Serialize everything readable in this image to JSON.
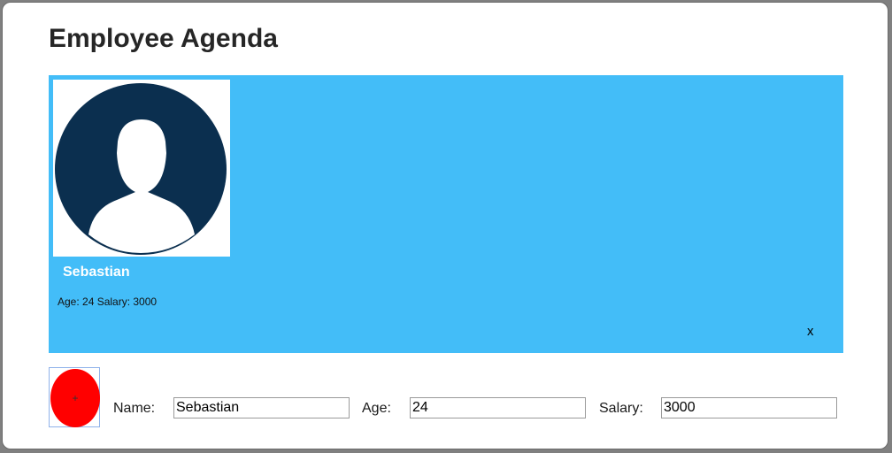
{
  "page": {
    "title": "Employee Agenda"
  },
  "employee_card": {
    "name": "Sebastian",
    "details": "Age: 24 Salary: 3000",
    "delete_label": "x",
    "avatar_icon": "person-silhouette-icon",
    "background_color": "#43bdf8"
  },
  "add_button": {
    "label": "+",
    "color": "#ff0000"
  },
  "form": {
    "name_label": "Name:",
    "name_value": "Sebastian",
    "age_label": "Age:",
    "age_value": "24",
    "salary_label": "Salary:",
    "salary_value": "3000"
  }
}
